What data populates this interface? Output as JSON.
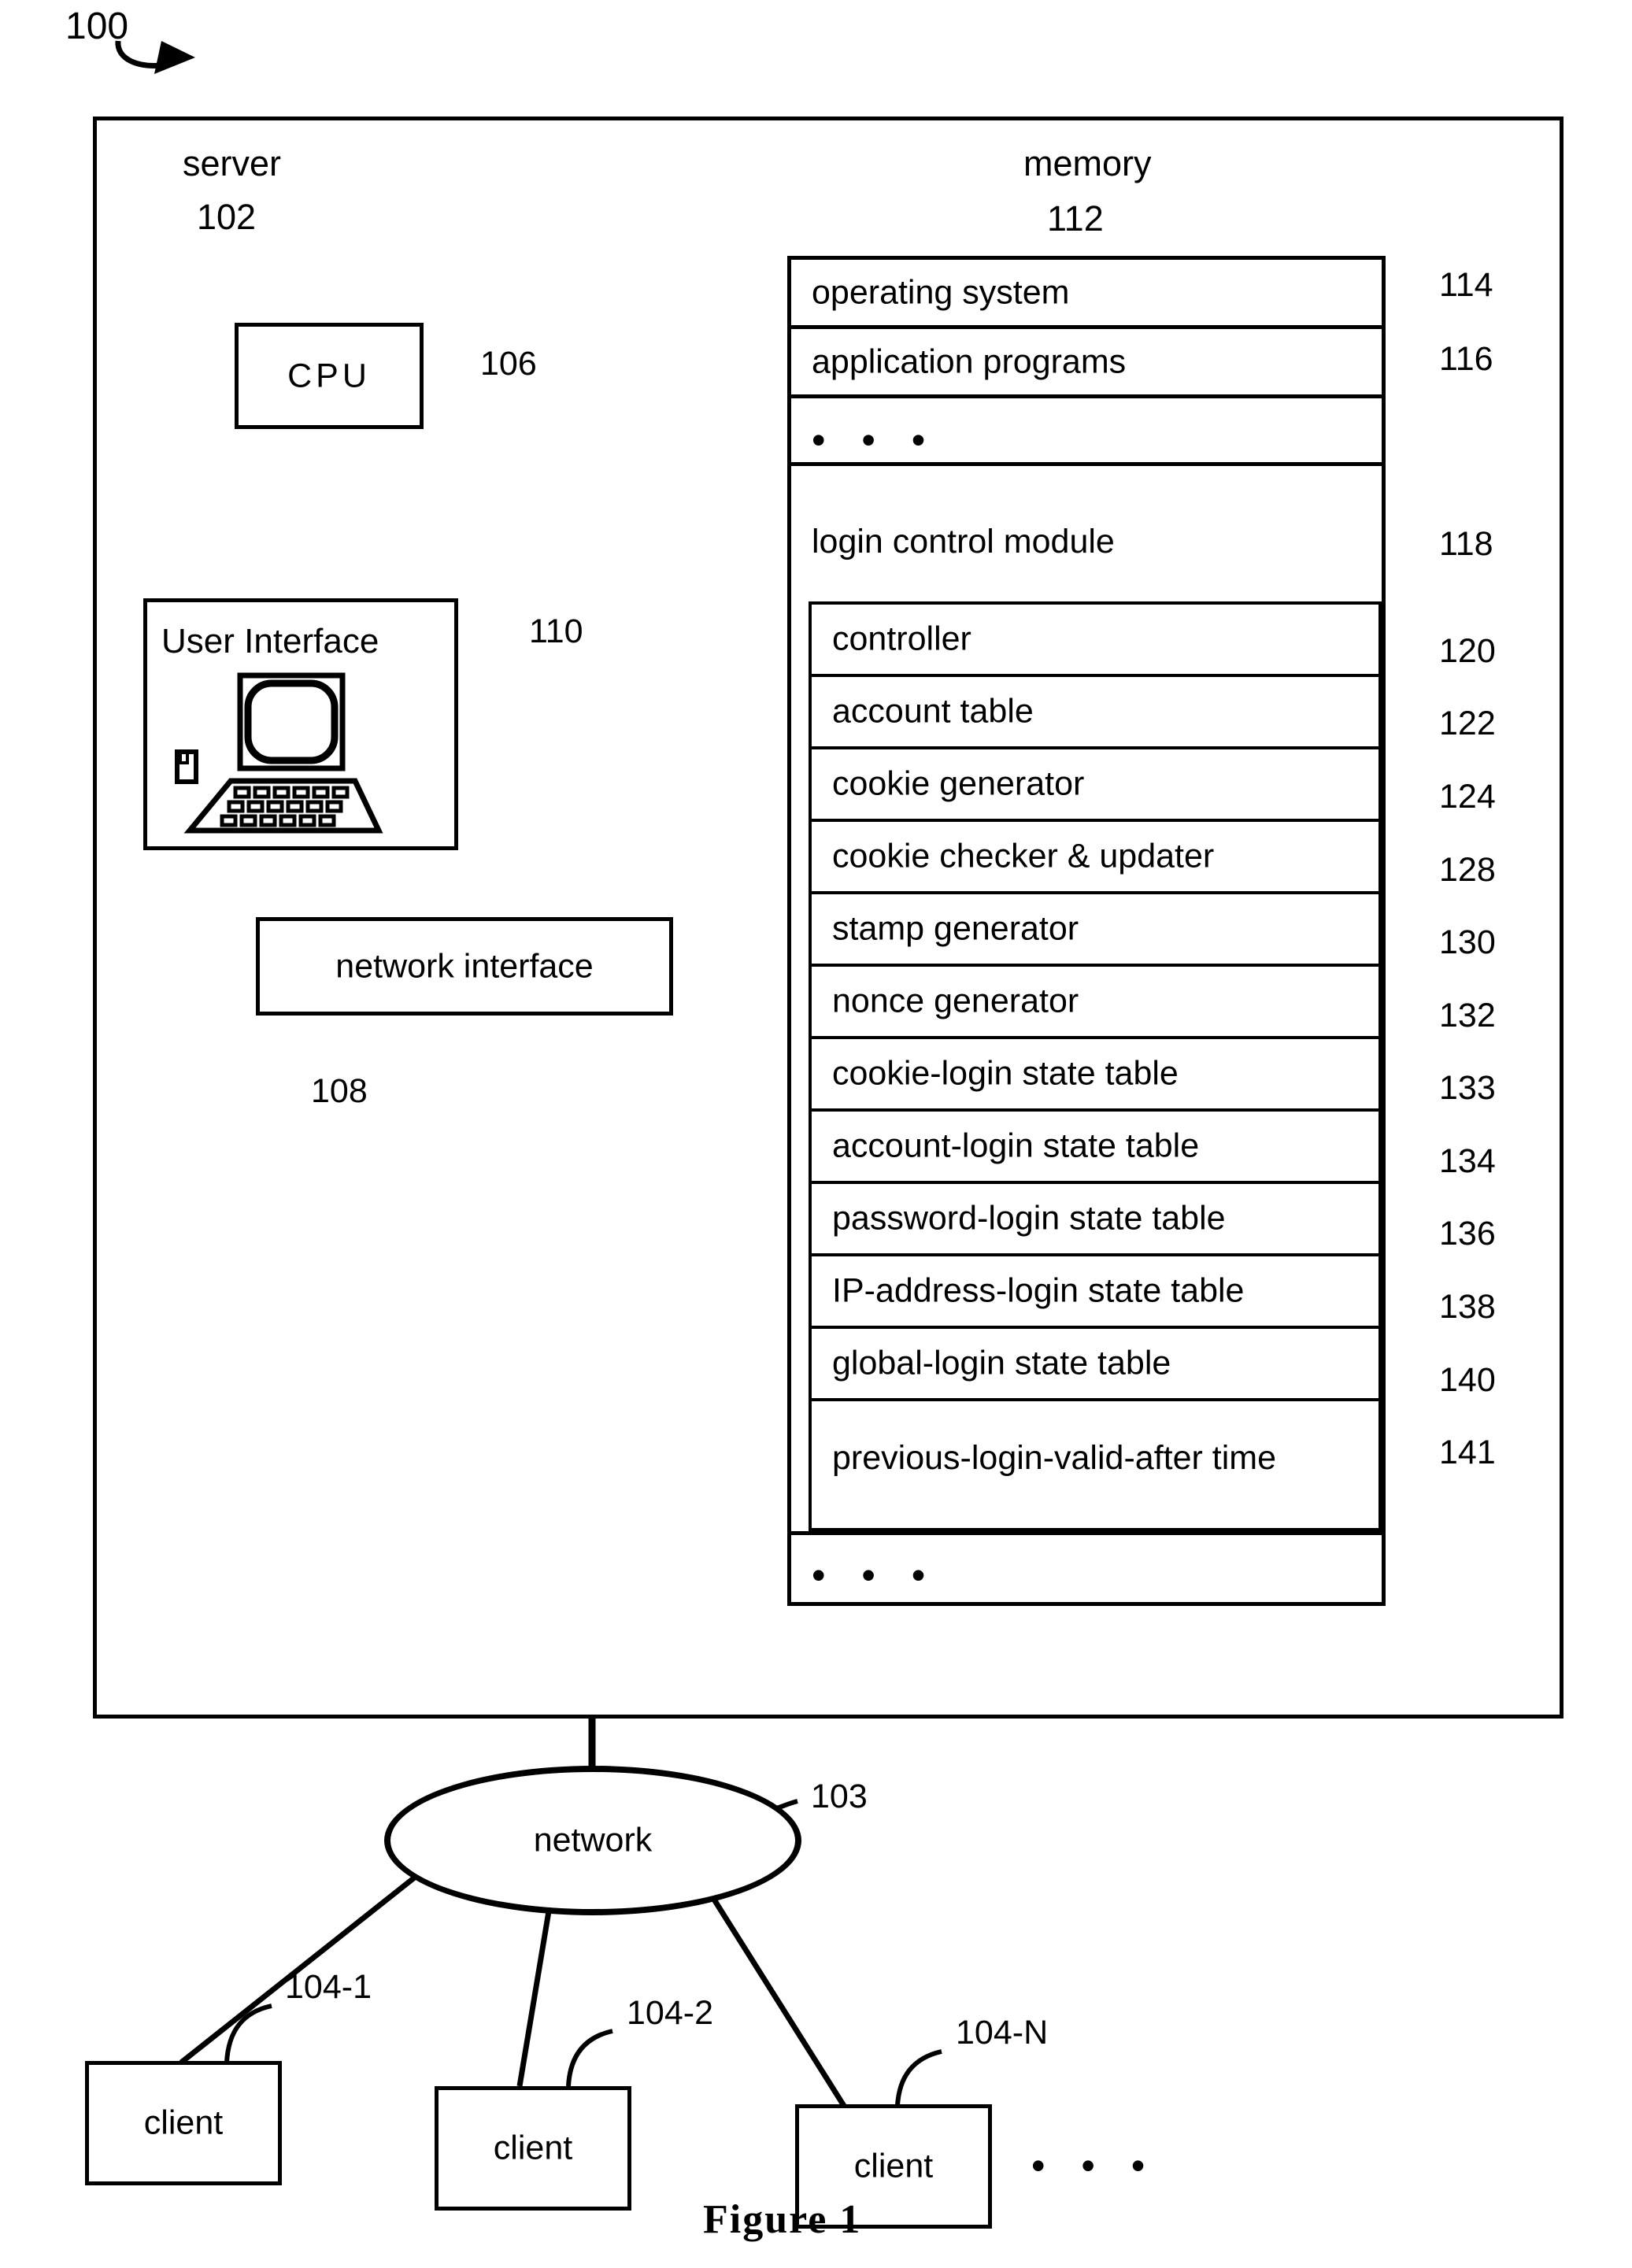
{
  "figure": {
    "caption": "Figure 1",
    "system_ref": "100"
  },
  "server": {
    "title": "server",
    "ref": "102",
    "cpu": {
      "label": "CPU",
      "ref": "106"
    },
    "user_interface": {
      "label": "User Interface",
      "ref": "110"
    },
    "network_interface": {
      "label": "network interface",
      "ref": "108"
    }
  },
  "memory": {
    "title": "memory",
    "ref": "112",
    "rows": [
      {
        "label": "operating system",
        "ref": "114"
      },
      {
        "label": "application programs",
        "ref": "116"
      },
      {
        "label": "• • •",
        "ref": ""
      },
      {
        "label": "login control module",
        "ref": "118"
      }
    ],
    "login_control_module": {
      "label": "login control module",
      "ref": "118",
      "items": [
        {
          "label": "controller",
          "ref": "120"
        },
        {
          "label": "account table",
          "ref": "122"
        },
        {
          "label": "cookie generator",
          "ref": "124"
        },
        {
          "label": "cookie checker & updater",
          "ref": "128"
        },
        {
          "label": "stamp generator",
          "ref": "130"
        },
        {
          "label": "nonce generator",
          "ref": "132"
        },
        {
          "label": "cookie-login state table",
          "ref": "133"
        },
        {
          "label": "account-login state table",
          "ref": "134"
        },
        {
          "label": "password-login state table",
          "ref": "136"
        },
        {
          "label": "IP-address-login state table",
          "ref": "138"
        },
        {
          "label": "global-login state table",
          "ref": "140"
        },
        {
          "label": "previous-login-valid-after time",
          "ref": "141"
        }
      ]
    },
    "trailing_ellipsis": "• • •"
  },
  "network": {
    "label": "network",
    "ref": "103"
  },
  "clients": [
    {
      "label": "client",
      "ref": "104-1"
    },
    {
      "label": "client",
      "ref": "104-2"
    },
    {
      "label": "client",
      "ref": "104-N"
    }
  ],
  "client_ellipsis": "• • •"
}
